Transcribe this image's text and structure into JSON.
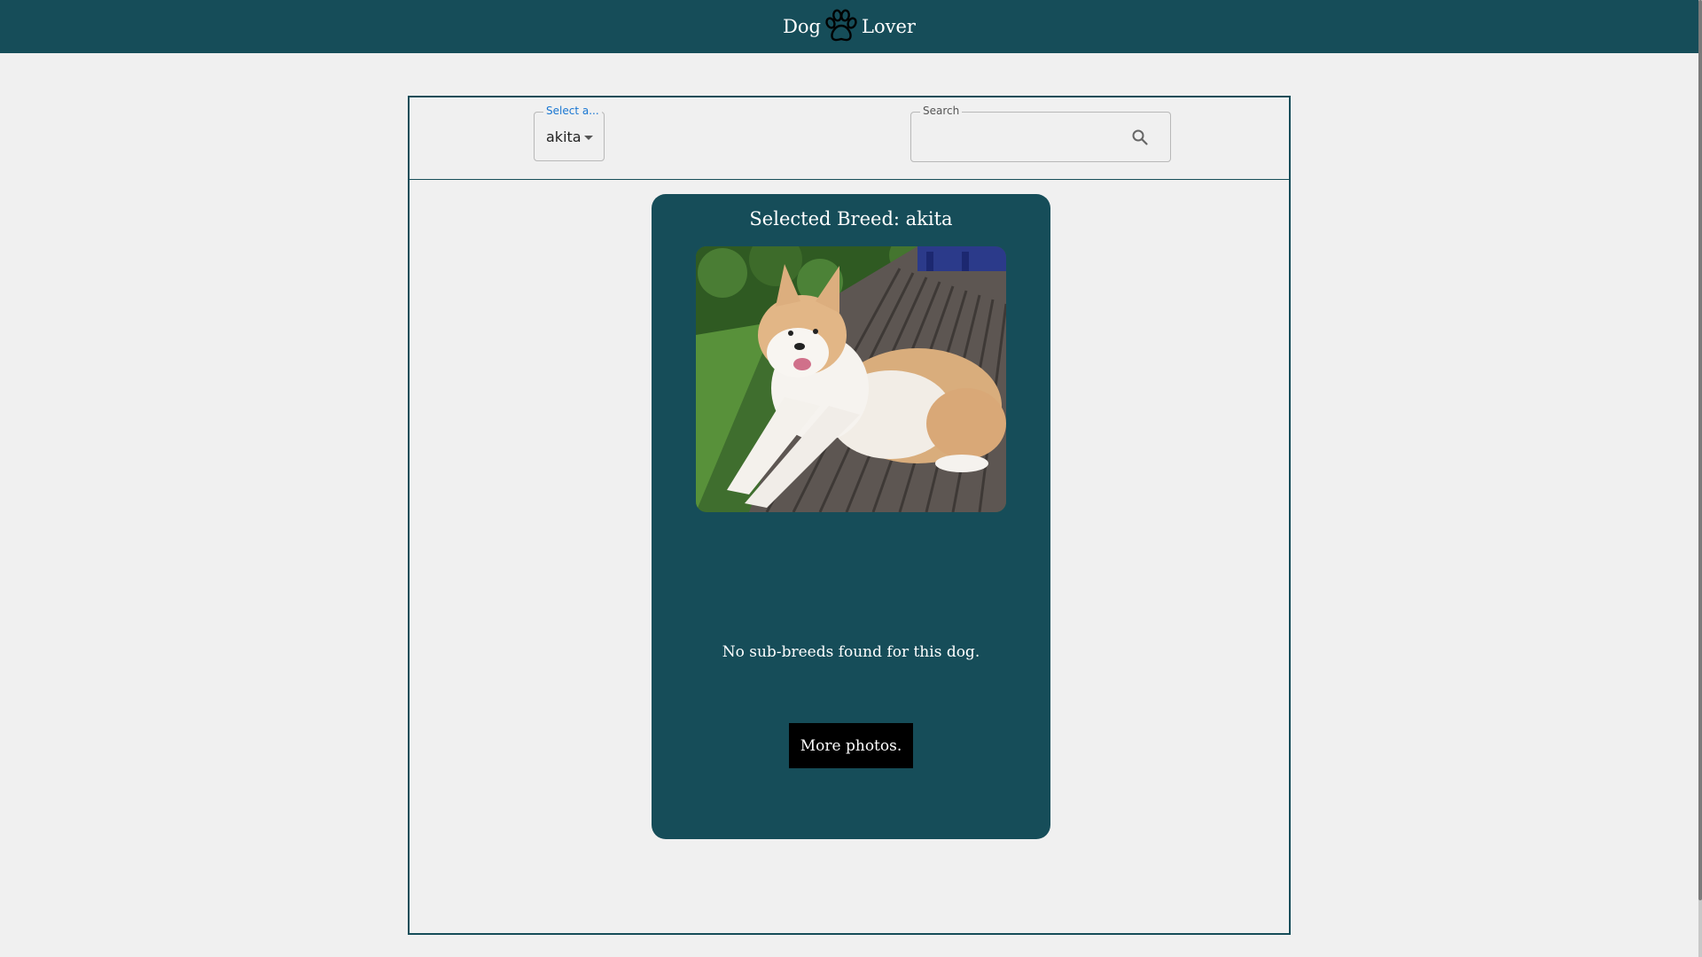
{
  "header": {
    "brand_left": "Dog",
    "brand_right": "Lover",
    "logo_icon": "paw-icon"
  },
  "controls": {
    "breed_select": {
      "label": "Select a...",
      "value": "akita",
      "icon": "caret-down-icon"
    },
    "search": {
      "label": "Search",
      "value": "",
      "icon": "search-icon"
    }
  },
  "card": {
    "title": "Selected Breed: akita",
    "photo_subject": "akita dog lying on wooden deck",
    "message": "No sub-breeds found for this dog.",
    "more_button": "More photos."
  },
  "colors": {
    "primary": "#164d59",
    "background": "#f0f0f0",
    "button": "#000000",
    "select_label": "#1976d2"
  }
}
